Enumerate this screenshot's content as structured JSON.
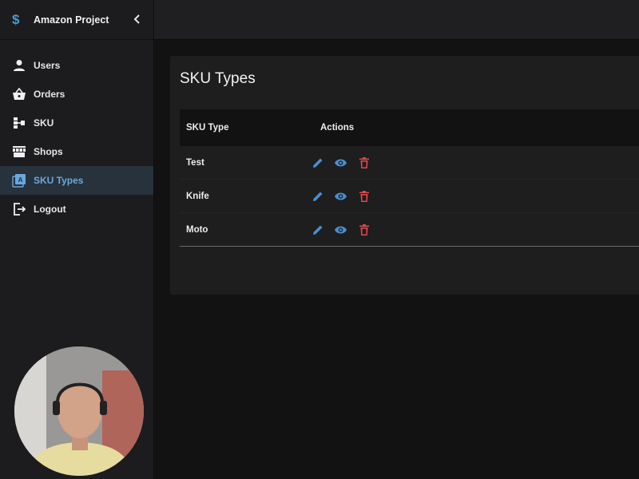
{
  "app": {
    "title": "Amazon Project",
    "logo_icon": "dollar-icon",
    "accent": "#4a9ad8"
  },
  "sidebar": {
    "items": [
      {
        "label": "Users",
        "icon": "user-icon",
        "active": false
      },
      {
        "label": "Orders",
        "icon": "basket-icon",
        "active": false
      },
      {
        "label": "SKU",
        "icon": "sku-tree-icon",
        "active": false
      },
      {
        "label": "Shops",
        "icon": "store-icon",
        "active": true
      },
      {
        "label": "SKU Types",
        "icon": "photo-library-icon",
        "active": true
      },
      {
        "label": "Logout",
        "icon": "logout-icon",
        "active": false
      }
    ]
  },
  "page": {
    "title": "SKU Types"
  },
  "table": {
    "headers": {
      "type": "SKU Type",
      "actions": "Actions"
    },
    "rows": [
      {
        "type": "Test"
      },
      {
        "type": "Knife"
      },
      {
        "type": "Moto"
      }
    ]
  },
  "colors": {
    "edit": "#4a8fd0",
    "view": "#4a8fd0",
    "delete": "#e04848",
    "active_bg": "#27323c"
  }
}
